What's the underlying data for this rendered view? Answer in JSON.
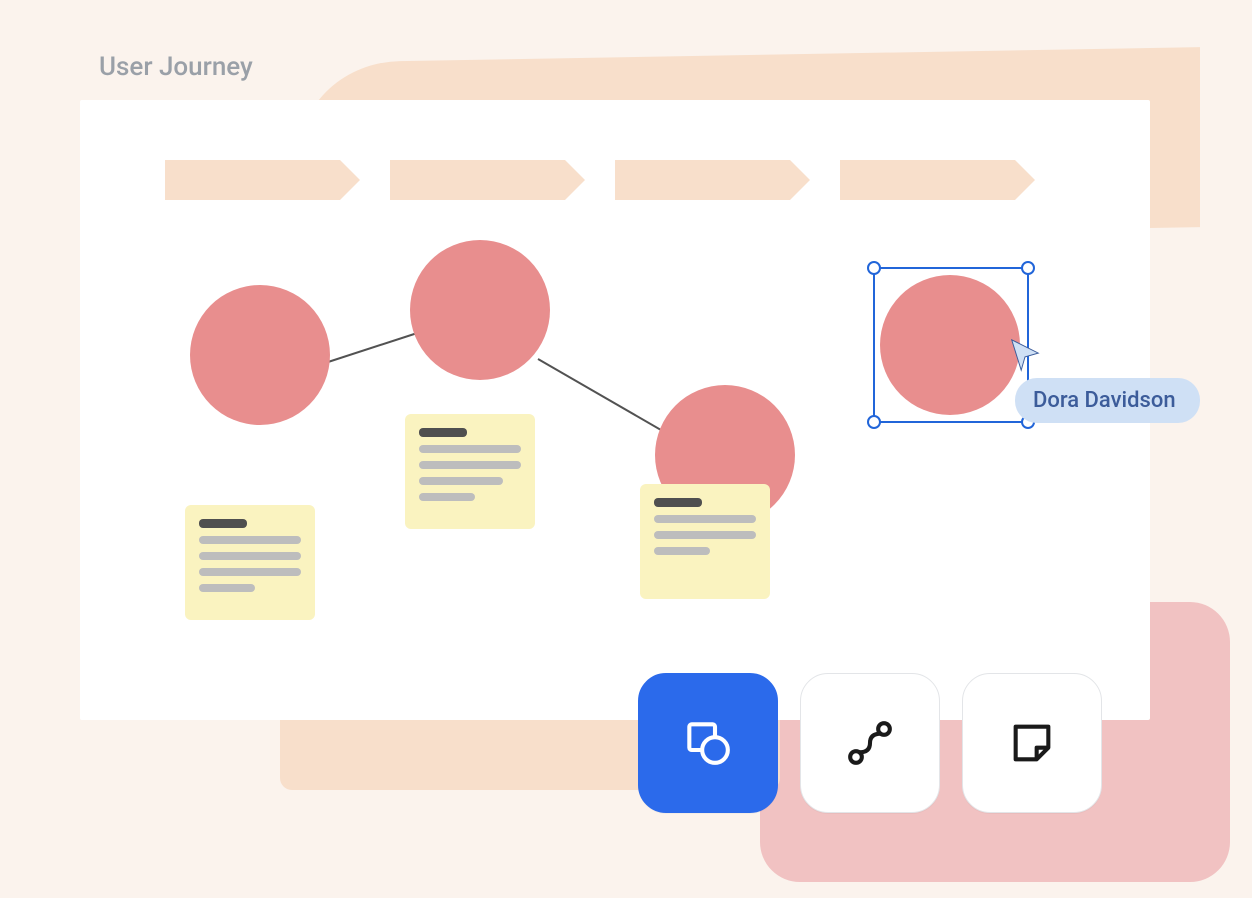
{
  "title": "User Journey",
  "collaborator": {
    "name": "Dora Davidson"
  },
  "toolbar": {
    "shapes_tool": "shapes",
    "connector_tool": "connector",
    "sticky_tool": "sticky-note",
    "active": "shapes"
  },
  "colors": {
    "node": "#E88E8E",
    "accent": "#2B6AEB",
    "sticky": "#FAF3C0",
    "chevron": "#F8DFCB"
  }
}
